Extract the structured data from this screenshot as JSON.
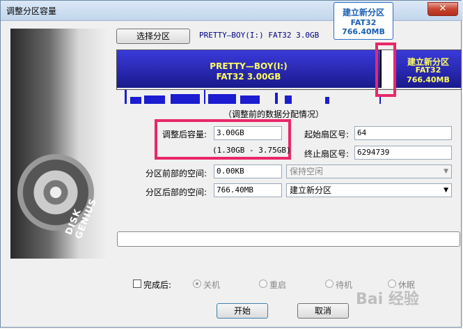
{
  "window": {
    "title": "调整分区容量",
    "close_glyph": "✕"
  },
  "art": {
    "brand": "DISK GENIUS"
  },
  "toolbar": {
    "select_partition_label": "选择分区",
    "partition_info": "PRETTY—BOY(I:) FAT32 3.0GB"
  },
  "disk_map": {
    "segment1": {
      "line1": "PRETTY—BOY(I:)",
      "line2": "FAT32 3.00GB"
    },
    "segment2": {
      "line1": "建立新分区",
      "line2": "FAT32",
      "line3": "766.40MB"
    },
    "tooltip": {
      "line1": "建立新分区",
      "line2": "FAT32",
      "line3": "766.40MB"
    },
    "caption": "（调整前的数据分配情况）"
  },
  "form": {
    "new_size_label": "调整后容量:",
    "new_size_value": "3.00GB",
    "range_text": "(1.30GB - 3.75GB)",
    "start_sector_label": "起始扇区号:",
    "start_sector_value": "64",
    "end_sector_label": "终止扇区号:",
    "end_sector_value": "6294739",
    "space_before_label": "分区前部的空间:",
    "space_before_value": "0.00KB",
    "space_before_action": "保持空闲",
    "space_after_label": "分区后部的空间:",
    "space_after_value": "766.40MB",
    "space_after_action": "建立新分区"
  },
  "after_completion": {
    "label": "完成后:",
    "options": [
      "关机",
      "重启",
      "待机",
      "休眠"
    ]
  },
  "buttons": {
    "start": "开始",
    "cancel": "取消"
  },
  "watermark": "Bai 经验",
  "colors": {
    "partition_fill": "#1a1a8c",
    "label_text": "#ffff60",
    "highlight": "#e8276a",
    "tooltip_text": "#1a5fb4"
  }
}
